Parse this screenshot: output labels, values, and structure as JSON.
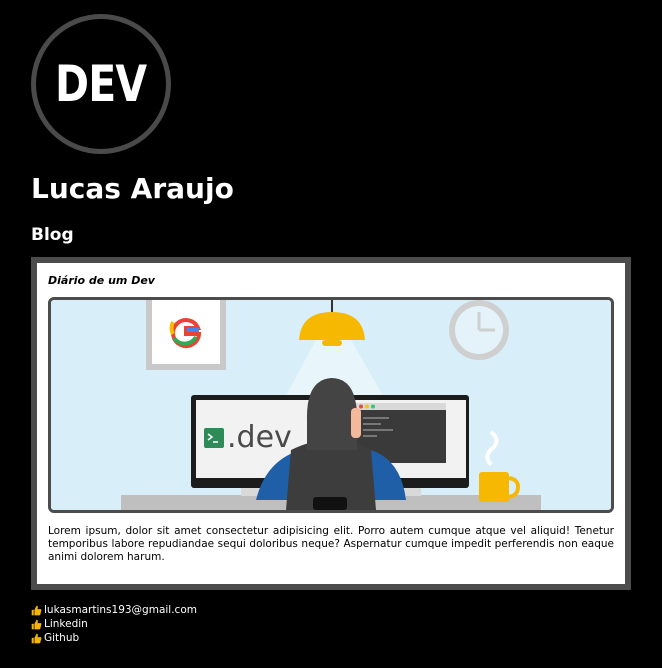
{
  "logo": {
    "text": "DEV"
  },
  "profile": {
    "name": "Lucas Araujo"
  },
  "blog": {
    "heading": "Blog",
    "post": {
      "title": "Diário de um Dev",
      "image_text": ".dev",
      "body": "Lorem ipsum, dolor sit amet consectetur adipisicing elit. Porro autem cumque atque vel aliquid! Tenetur temporibus labore repudiandae sequi doloribus neque? Aspernatur cumque impedit perferendis non eaque animi dolorem harum."
    }
  },
  "contacts": [
    {
      "icon": "thumbs-up-icon",
      "label": "lukasmartins193@gmail.com"
    },
    {
      "icon": "thumbs-up-icon",
      "label": "Linkedin"
    },
    {
      "icon": "thumbs-up-icon",
      "label": "Github"
    }
  ],
  "colors": {
    "background": "#000000",
    "card_border": "#4c4c4c",
    "logo_ring": "#4a4a4a",
    "thumb": "#f5b400"
  }
}
